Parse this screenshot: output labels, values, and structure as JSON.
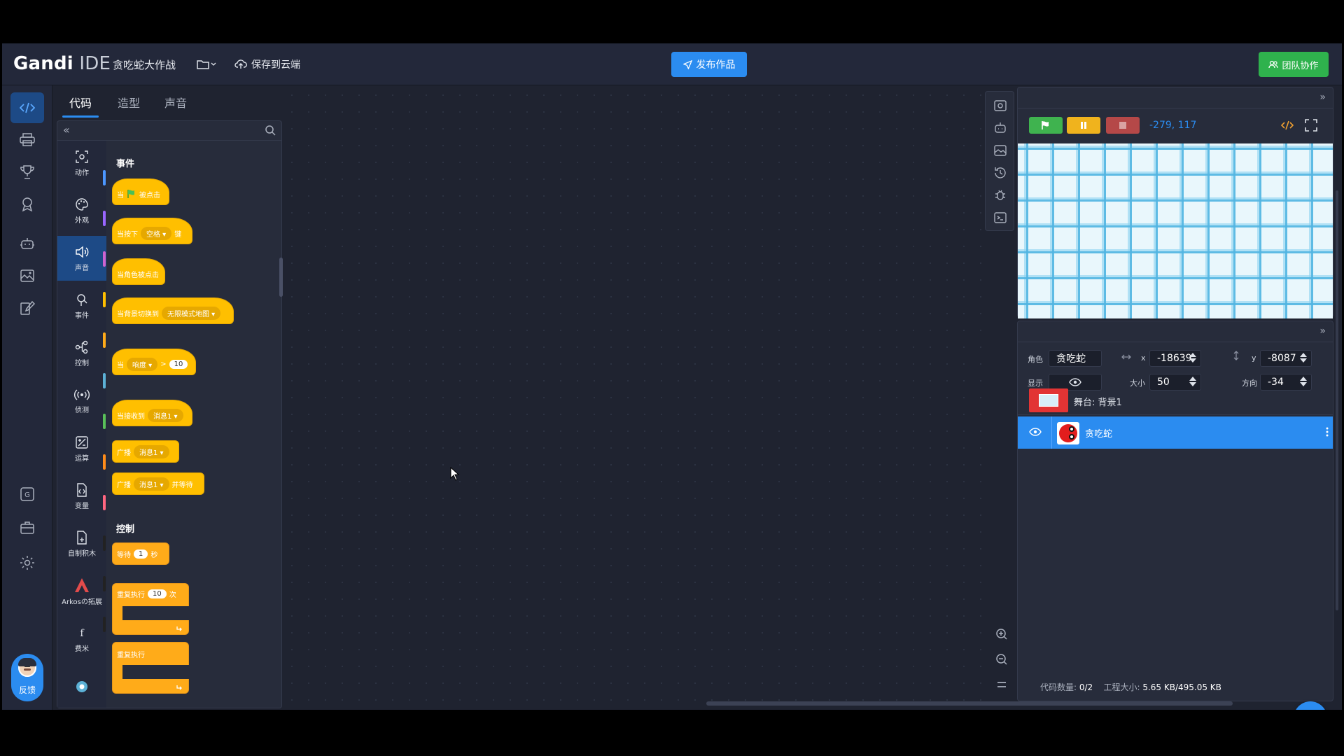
{
  "header": {
    "logo_main": "Gandi",
    "logo_sub": "IDE",
    "project_title": "贪吃蛇大作战",
    "save_label": "保存到云端",
    "publish_label": "发布作品",
    "team_label": "团队协作"
  },
  "tabs": [
    {
      "label": "代码",
      "active": true
    },
    {
      "label": "造型"
    },
    {
      "label": "声音"
    }
  ],
  "palette": {
    "collapse_glyph": "«",
    "categories": [
      {
        "label": "动作",
        "color": "#4c97ff"
      },
      {
        "label": "外观",
        "color": "#9966ff"
      },
      {
        "label": "声音",
        "color": "#cf63cf"
      },
      {
        "label": "事件",
        "color": "#ffbf00"
      },
      {
        "label": "控制",
        "color": "#ffab19"
      },
      {
        "label": "侦测",
        "color": "#5cb1d6"
      },
      {
        "label": "运算",
        "color": "#59c059"
      },
      {
        "label": "变量",
        "color": "#ff8c1a"
      },
      {
        "label": "自制积木",
        "color": "#ff6680"
      },
      {
        "label": "Arkosの拓展",
        "color": "#e34b4b"
      },
      {
        "label": "费米",
        "color": "#222222"
      }
    ],
    "sections": {
      "events": "事件",
      "control": "控制"
    },
    "blocks": {
      "flag_when": "当",
      "flag_clicked": "被点击",
      "key_when": "当按下",
      "key_value": "空格",
      "key_suffix": "键",
      "sprite_clicked": "当角色被点击",
      "backdrop_when": "当背景切换到",
      "backdrop_value": "无限模式地图",
      "loudness_when": "当",
      "loudness_value": "响度",
      "loudness_op": ">",
      "loudness_num": "10",
      "receive_when": "当接收到",
      "receive_value": "消息1",
      "broadcast_label": "广播",
      "broadcast_value": "消息1",
      "broadcast_wait_label": "广播",
      "broadcast_wait_value": "消息1",
      "broadcast_wait_suffix": "并等待",
      "wait_label": "等待",
      "wait_num": "1",
      "wait_suffix": "秒",
      "repeat_label": "重复执行",
      "repeat_num": "10",
      "repeat_suffix": "次",
      "forever_label": "重复执行"
    }
  },
  "stage_controls": {
    "coords": "-279, 117"
  },
  "sprite_info": {
    "sprite_label": "角色",
    "sprite_name": "贪吃蛇",
    "x_label": "x",
    "x_value": "-18639",
    "y_label": "y",
    "y_value": "-8087",
    "show_label": "显示",
    "size_label": "大小",
    "size_value": "50",
    "direction_label": "方向",
    "direction_value": "-34"
  },
  "sprite_list": {
    "stage_label": "舞台: 背景1",
    "sprite_name": "贪吃蛇"
  },
  "footer": {
    "code_count_label": "代码数量:",
    "code_count_value": "0/2",
    "project_size_label": "工程大小:",
    "project_size_value": "5.65 KB/495.05 KB"
  },
  "icons": {
    "file": "folder-icon",
    "save": "cloud-upload-icon",
    "publish": "send-icon",
    "team": "team-icon",
    "green_flag": "green-flag-icon",
    "pause": "pause-icon",
    "stop": "stop-icon",
    "add": "plus-icon"
  },
  "colors": {
    "accent": "#2b8cf0",
    "event_block": "#ffbf00",
    "green": "#2fb24d"
  }
}
